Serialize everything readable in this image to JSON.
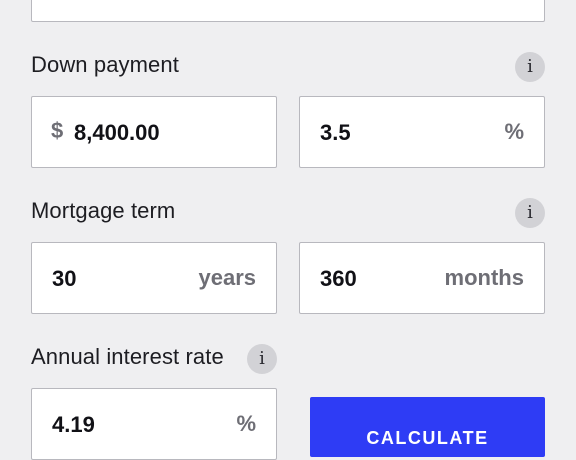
{
  "down_payment": {
    "label": "Down payment",
    "info_glyph": "i",
    "currency_symbol": "$",
    "amount_value": "8,400.00",
    "percent_value": "3.5",
    "percent_unit": "%"
  },
  "mortgage_term": {
    "label": "Mortgage term",
    "info_glyph": "i",
    "years_value": "30",
    "years_unit": "years",
    "months_value": "360",
    "months_unit": "months"
  },
  "interest_rate": {
    "label": "Annual interest rate",
    "info_glyph": "i",
    "rate_value": "4.19",
    "rate_unit": "%"
  },
  "actions": {
    "calculate_label": "CALCULATE"
  },
  "colors": {
    "background": "#efeff1",
    "field_border": "#b8b8be",
    "accent_button": "#2e3cf5",
    "info_icon_bg": "#d2d2d6",
    "unit_text": "#6e6e75"
  },
  "icons": {
    "info": "info-icon"
  }
}
